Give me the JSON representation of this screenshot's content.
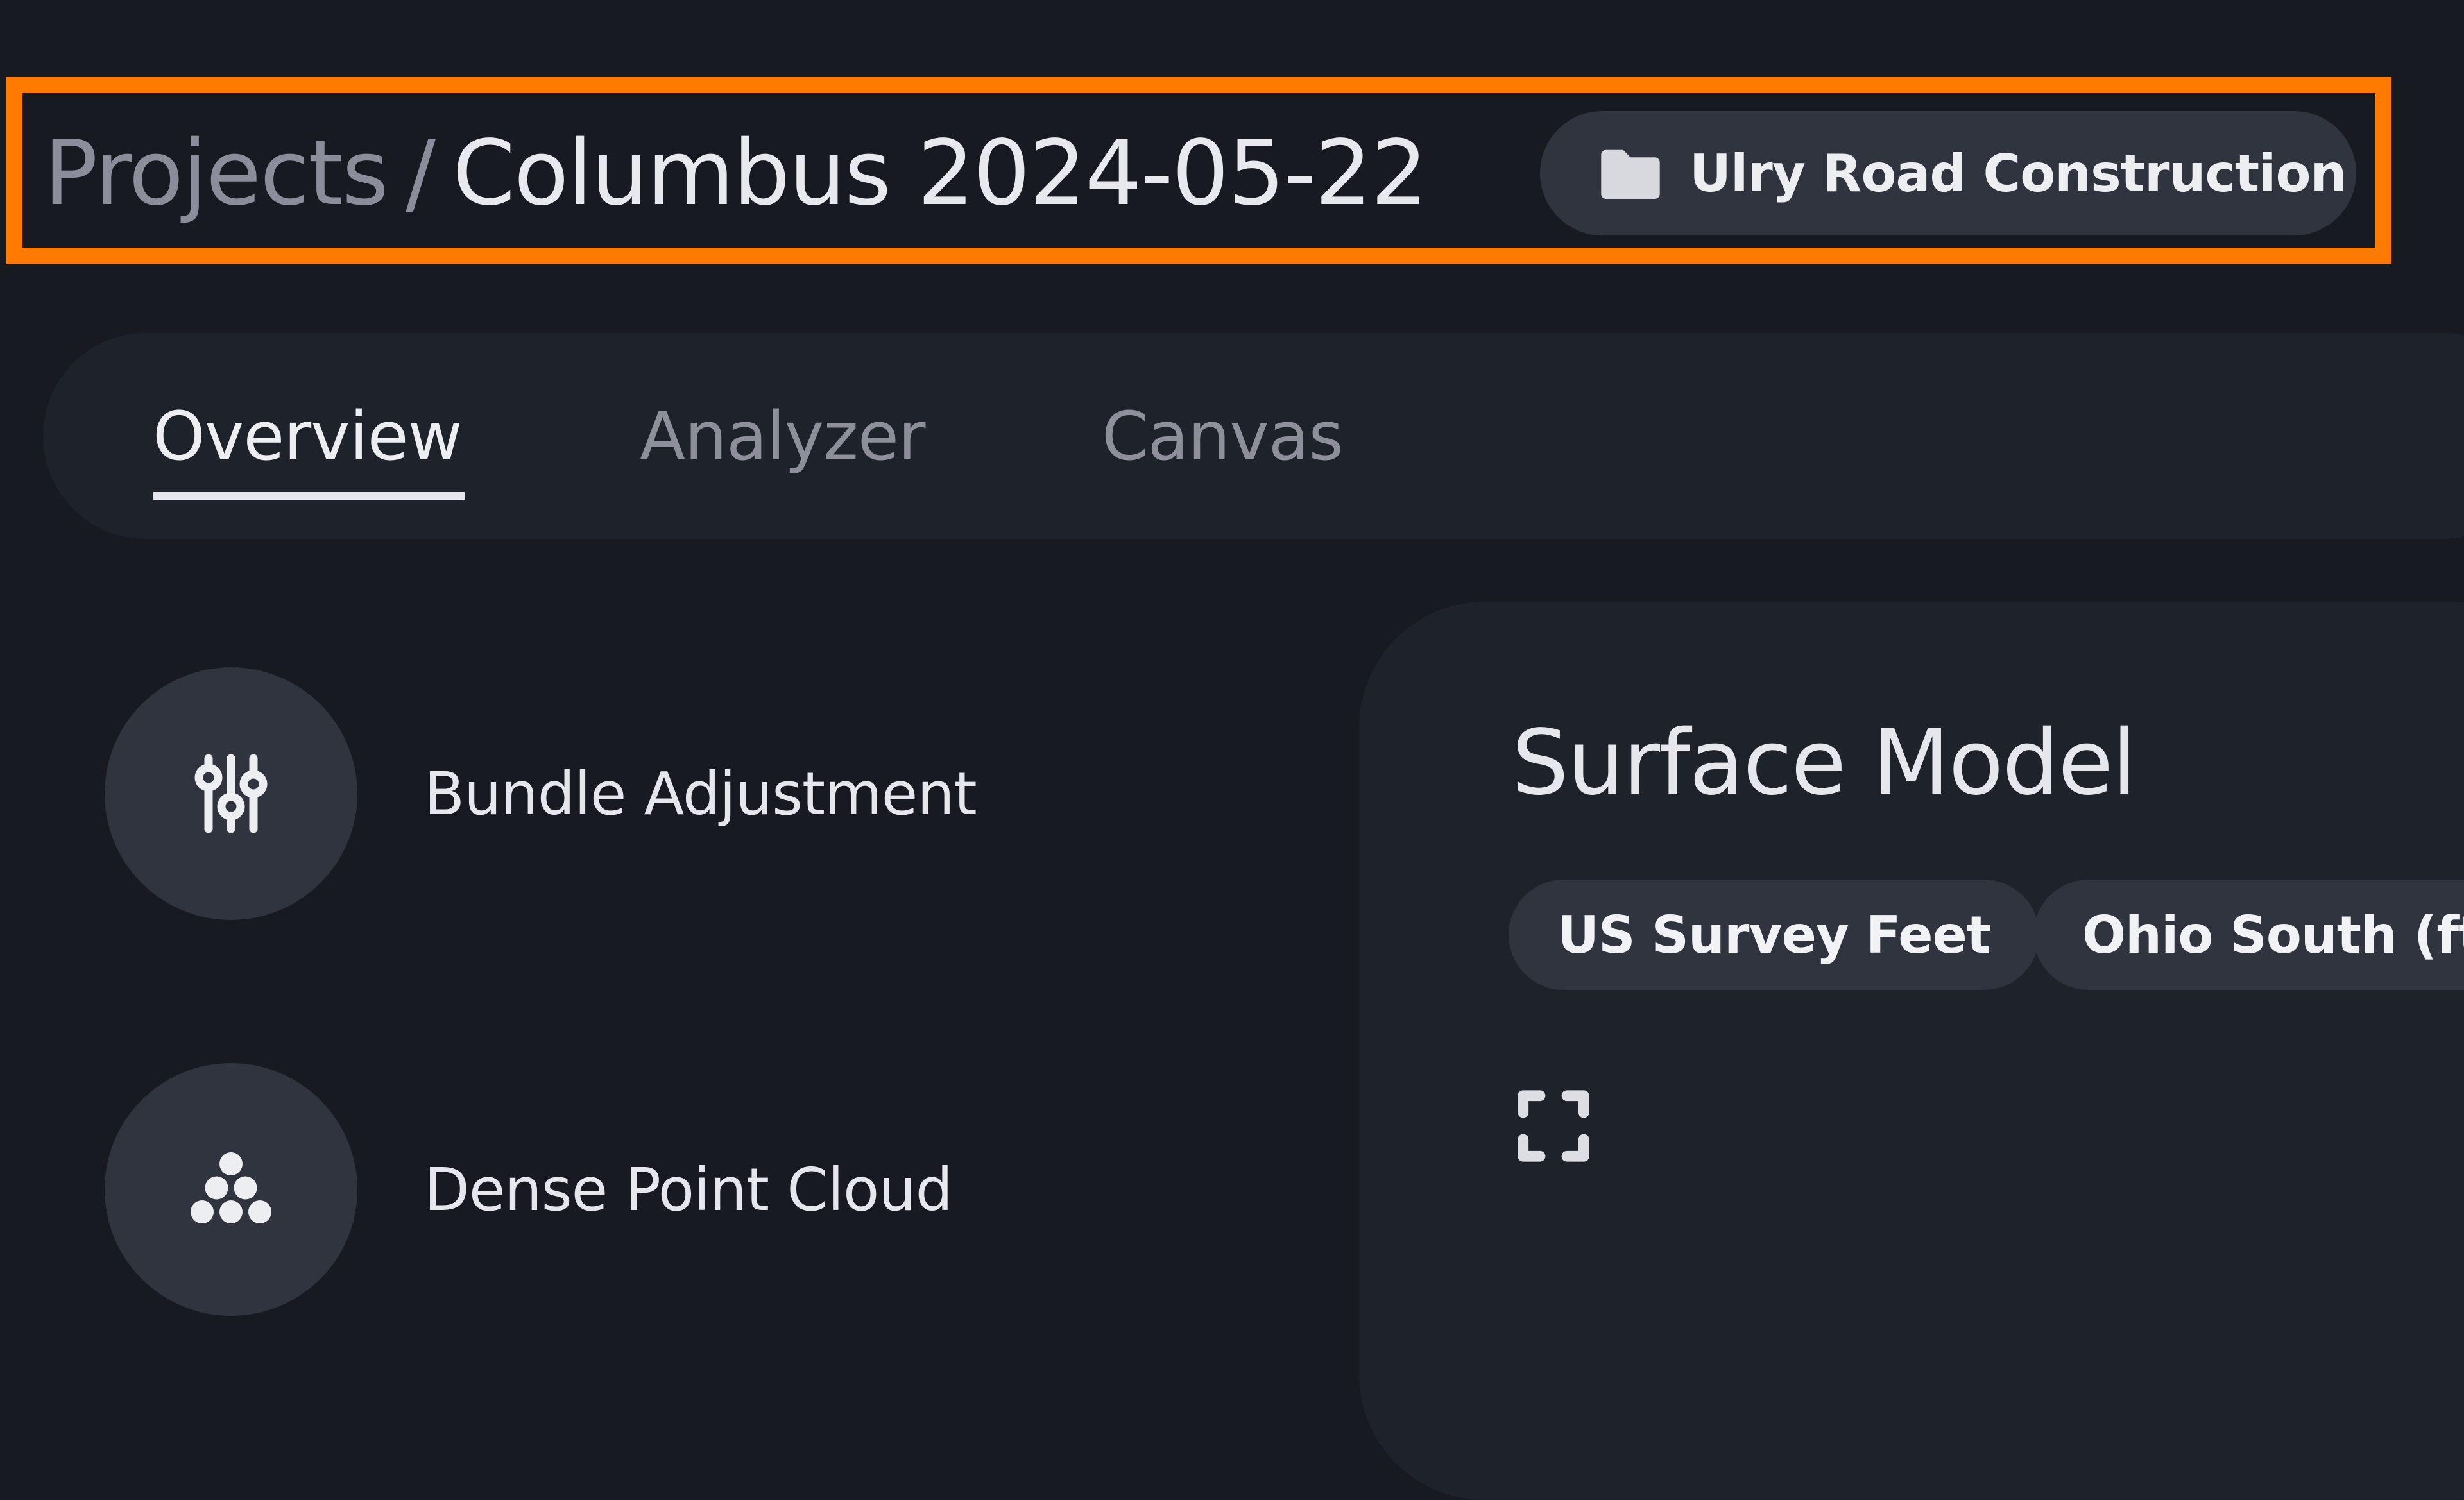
{
  "breadcrumb": {
    "root": "Projects",
    "separator": "/",
    "current": "Columbus 2024-05-22"
  },
  "project_chip": {
    "icon": "folder-icon",
    "label": "Ulry Road Construction"
  },
  "tabs": [
    {
      "label": "Overview",
      "active": true
    },
    {
      "label": "Analyzer",
      "active": false
    },
    {
      "label": "Canvas",
      "active": false
    }
  ],
  "list": [
    {
      "icon": "sliders-icon",
      "label": "Bundle Adjustment"
    },
    {
      "icon": "point-cloud-icon",
      "label": "Dense Point Cloud"
    }
  ],
  "panel": {
    "title": "Surface Model",
    "chips": [
      "US Survey Feet",
      "Ohio South (ftUS)"
    ],
    "expand_icon": "expand-icon"
  },
  "colors": {
    "highlight": "#ff7a00",
    "background": "#171a21",
    "surface": "#1e222a",
    "chip": "#30343f"
  }
}
